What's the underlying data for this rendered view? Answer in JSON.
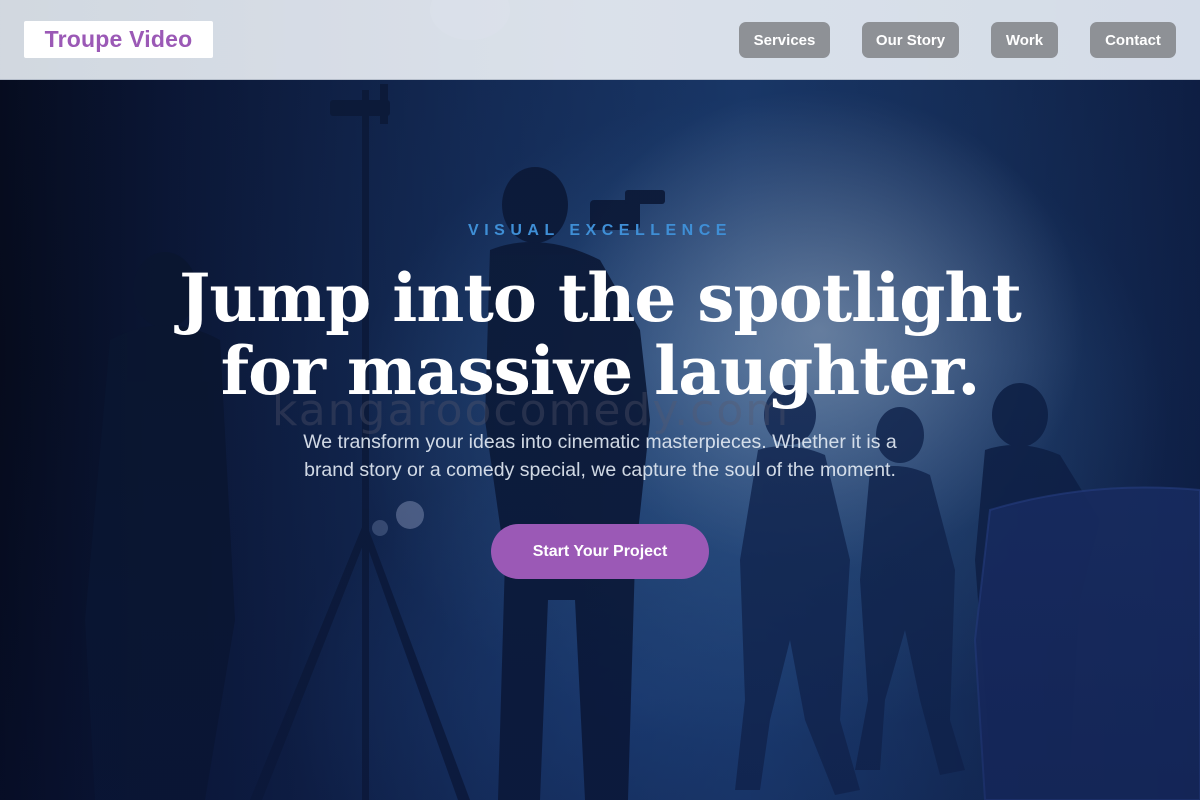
{
  "header": {
    "brand": "Troupe Video",
    "nav": [
      {
        "label": "Services"
      },
      {
        "label": "Our Story"
      },
      {
        "label": "Work"
      },
      {
        "label": "Contact"
      }
    ]
  },
  "hero": {
    "eyebrow": "VISUAL EXCELLENCE",
    "headline_line1": "Jump into the spotlight",
    "headline_line2": "for massive laughter.",
    "watermark": "kangaroocomedy.com",
    "subtext_line1": "We transform your ideas into cinematic masterpieces. Whether it is a",
    "subtext_line2": "brand story or a comedy special, we capture the soul of the moment.",
    "cta_label": "Start Your Project"
  },
  "colors": {
    "brand": "#9b59b6",
    "accent": "#3f8fd6",
    "nav_button": "#8e9196"
  }
}
